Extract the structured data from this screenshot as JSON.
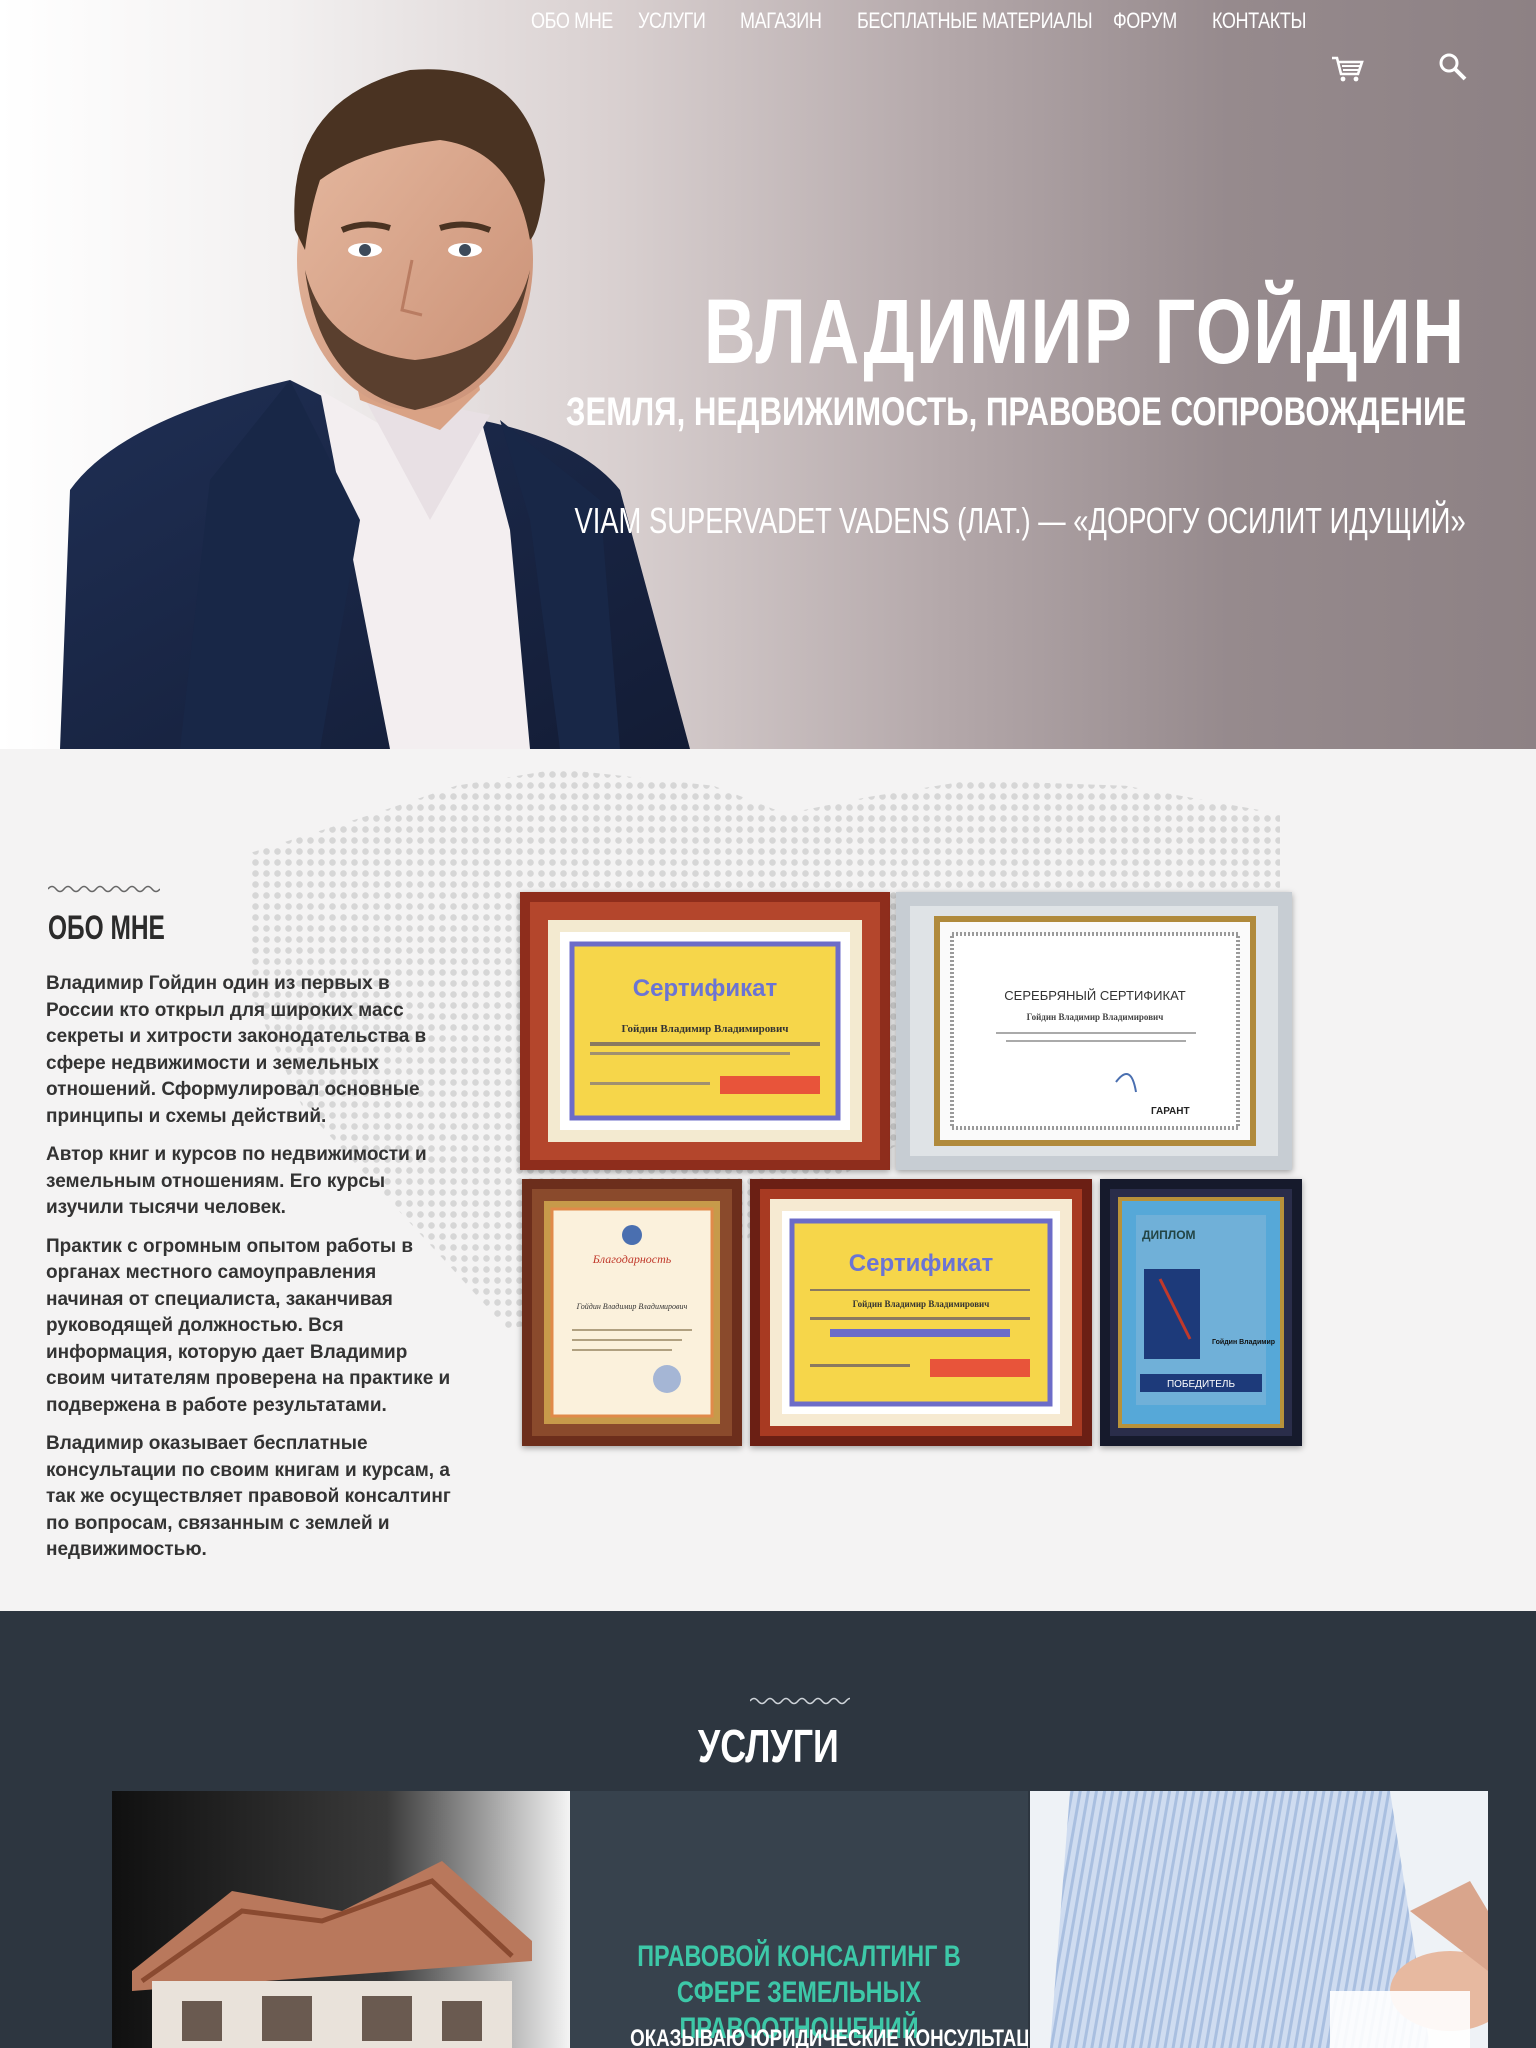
{
  "nav": {
    "items": [
      "ОБО МНЕ",
      "УСЛУГИ",
      "МАГАЗИН",
      "БЕСПЛАТНЫЕ МАТЕРИАЛЫ",
      "ФОРУМ",
      "КОНТАКТЫ"
    ],
    "cart_icon": "cart-icon",
    "search_icon": "search-icon"
  },
  "hero": {
    "name": "ВЛАДИМИР ГОЙДИН",
    "subtitle": "ЗЕМЛЯ, НЕДВИЖИМОСТЬ, ПРАВОВОЕ СОПРОВОЖДЕНИЕ",
    "quote": "VIAM SUPERVADET VADENS (ЛАТ.) — «ДОРОГУ ОСИЛИТ ИДУЩИЙ»"
  },
  "about": {
    "title": "ОБО МНЕ",
    "paragraphs": [
      "Владимир Гойдин один из первых в России кто открыл для широких масс секреты и хитрости законодательства в сфере недвижимости и земельных отношений. Сформулировал основные принципы и схемы действий.",
      "Автор книг и курсов по недвижимости и земельным отношениям. Его курсы изучили тысячи человек.",
      "Практик с огромным опытом работы в органах местного самоуправления начиная от специалиста, заканчивая руководящей должностью. Вся информация, которую дает Владимир своим читателям проверена на практике и подвержена в работе результатами.",
      "Владимир оказывает бесплатные консультации по своим книгам и курсам, а так же осуществляет правовой консалтинг по вопросам, связанным с землей и недвижимостью."
    ],
    "certificates": [
      {
        "title": "Сертификат",
        "holder": "Гойдин Владимир Владимирович"
      },
      {
        "title": "СЕРЕБРЯНЫЙ СЕРТИФИКАТ",
        "holder": "Гойдин Владимир Владимирович",
        "brand": "ГАРАНТ"
      },
      {
        "title": "Благодарность",
        "holder": "Гойдин Владимир Владимирович"
      },
      {
        "title": "Сертификат",
        "holder": "Гойдин Владимир Владимирович"
      },
      {
        "title": "ДИПЛОМ",
        "holder": "Гойдин Владимир",
        "badge": "ПОБЕДИТЕЛЬ"
      }
    ]
  },
  "services": {
    "title": "УСЛУГИ",
    "cards": [
      {
        "title": "ПРАВОВОЙ КОНСАЛТИНГ В СФЕРЕ ЗЕМЕЛЬНЫХ ПРАВООТНОШЕНИЙ",
        "desc": "ОКАЗЫВАЮ ЮРИДИЧЕСКИЕ КОНСУЛЬТАЦИИ"
      }
    ]
  },
  "colors": {
    "accent": "#3dc8a8",
    "services_bg": "#2d3640",
    "services_card_bg": "#37424d"
  }
}
